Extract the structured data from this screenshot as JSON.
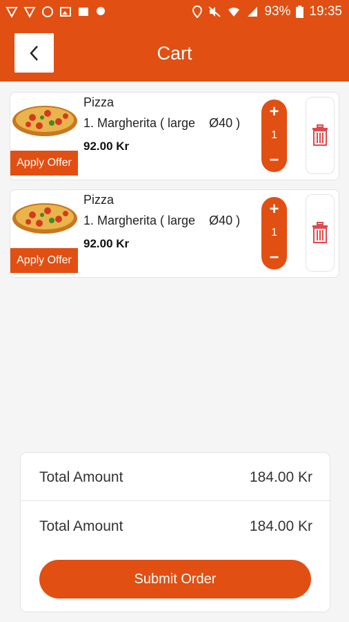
{
  "status_bar": {
    "battery_percent": "93%",
    "time": "19:35",
    "icons": [
      "cursor-icon",
      "cursor-icon",
      "whatsapp-icon",
      "image-icon",
      "news-icon",
      "chat-icon",
      "location-icon",
      "mute-icon",
      "wifi-icon",
      "signal-icon",
      "battery-icon"
    ]
  },
  "header": {
    "title": "Cart",
    "back_icon": "chevron-left-icon"
  },
  "cart": {
    "items": [
      {
        "category": "Pizza",
        "name": "1. Margherita ( large    Ø40 )",
        "price": "92.00 Kr",
        "quantity": "1",
        "offer_label": "Apply Offer",
        "plus_label": "+",
        "minus_label": "−"
      },
      {
        "category": "Pizza",
        "name": "1. Margherita ( large    Ø40 )",
        "price": "92.00 Kr",
        "quantity": "1",
        "offer_label": "Apply Offer",
        "plus_label": "+",
        "minus_label": "−"
      }
    ]
  },
  "summary": {
    "rows": [
      {
        "label": "Total Amount",
        "value": "184.00 Kr"
      },
      {
        "label": "Total Amount",
        "value": "184.00 Kr"
      }
    ],
    "submit_label": "Submit Order"
  },
  "colors": {
    "accent": "#e14f12",
    "background": "#f5f5f5",
    "card": "#ffffff"
  }
}
